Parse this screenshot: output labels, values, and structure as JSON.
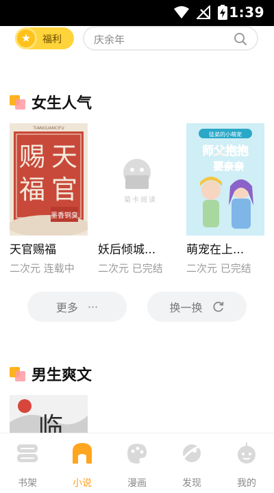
{
  "status_bar": {
    "time": "1:39"
  },
  "header": {
    "welfare_label": "福利",
    "search_placeholder": "庆余年"
  },
  "sections": [
    {
      "title": "女生人气",
      "books": [
        {
          "title": "天官赐福",
          "meta": "二次元 连载中",
          "cover_text": [
            "赐",
            "天",
            "福",
            "官"
          ],
          "cover_bottom": "墨香铜臭",
          "cover_top": "TIANGUANCIFU"
        },
        {
          "title": "妖后倾城...",
          "meta": "二次元 已完结",
          "cover_text": [
            "菊",
            "卡",
            "阅",
            "读"
          ]
        },
        {
          "title": "萌宠在上...",
          "meta": "二次元 已完结",
          "cover_text": [
            "师父抱抱",
            "要亲亲"
          ],
          "cover_top": "徒弟的小萌宠"
        }
      ],
      "more_label": "更多",
      "refresh_label": "换一换"
    },
    {
      "title": "男生爽文",
      "books": [
        {
          "cover_text": [
            "临"
          ]
        }
      ]
    }
  ],
  "bottom_nav": [
    {
      "label": "书架",
      "icon": "bookshelf-icon",
      "active": false
    },
    {
      "label": "小说",
      "icon": "novel-icon",
      "active": true
    },
    {
      "label": "漫画",
      "icon": "comic-icon",
      "active": false
    },
    {
      "label": "发现",
      "icon": "discover-icon",
      "active": false
    },
    {
      "label": "我的",
      "icon": "profile-icon",
      "active": false
    }
  ],
  "colors": {
    "accent": "#ff9f1a",
    "welfare_bg": "#ffd43a",
    "muted": "#9b9b9b"
  }
}
